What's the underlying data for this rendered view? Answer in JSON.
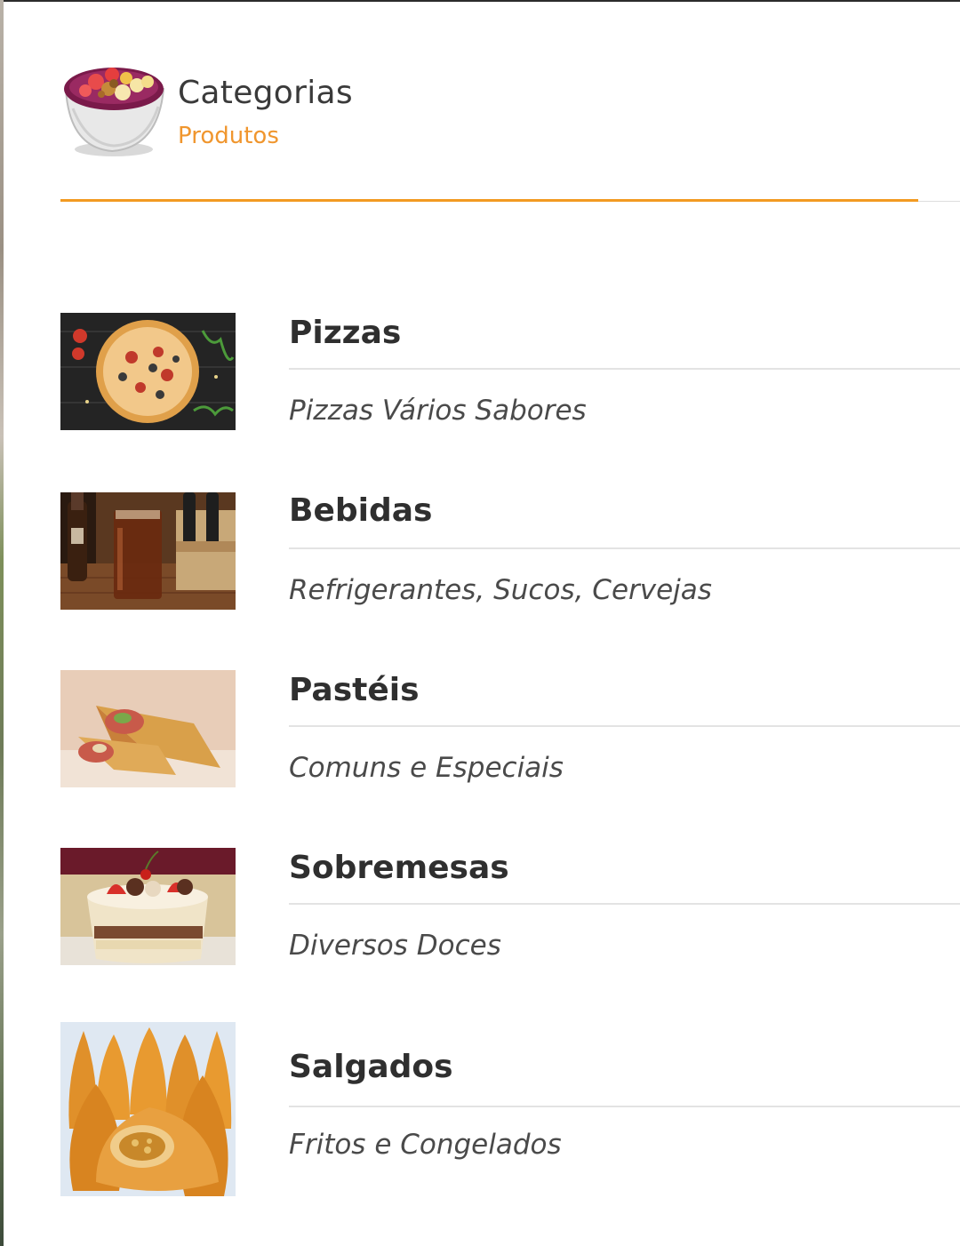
{
  "header": {
    "title": "Categorias",
    "subtitle": "Produtos",
    "logo_icon": "acai-bowl-icon",
    "accent_color": "#f29a21"
  },
  "categories": [
    {
      "name": "Pizzas",
      "description": "Pizzas Vários Sabores",
      "image": "pizza-photo"
    },
    {
      "name": "Bebidas",
      "description": "Refrigerantes, Sucos, Cervejas",
      "image": "soda-glass-photo"
    },
    {
      "name": "Pastéis",
      "description": "Comuns e Especiais",
      "image": "pastel-photo"
    },
    {
      "name": "Sobremesas",
      "description": "Diversos Doces",
      "image": "dessert-cup-photo"
    },
    {
      "name": "Salgados",
      "description": "Fritos e Congelados",
      "image": "coxinha-photo"
    }
  ]
}
